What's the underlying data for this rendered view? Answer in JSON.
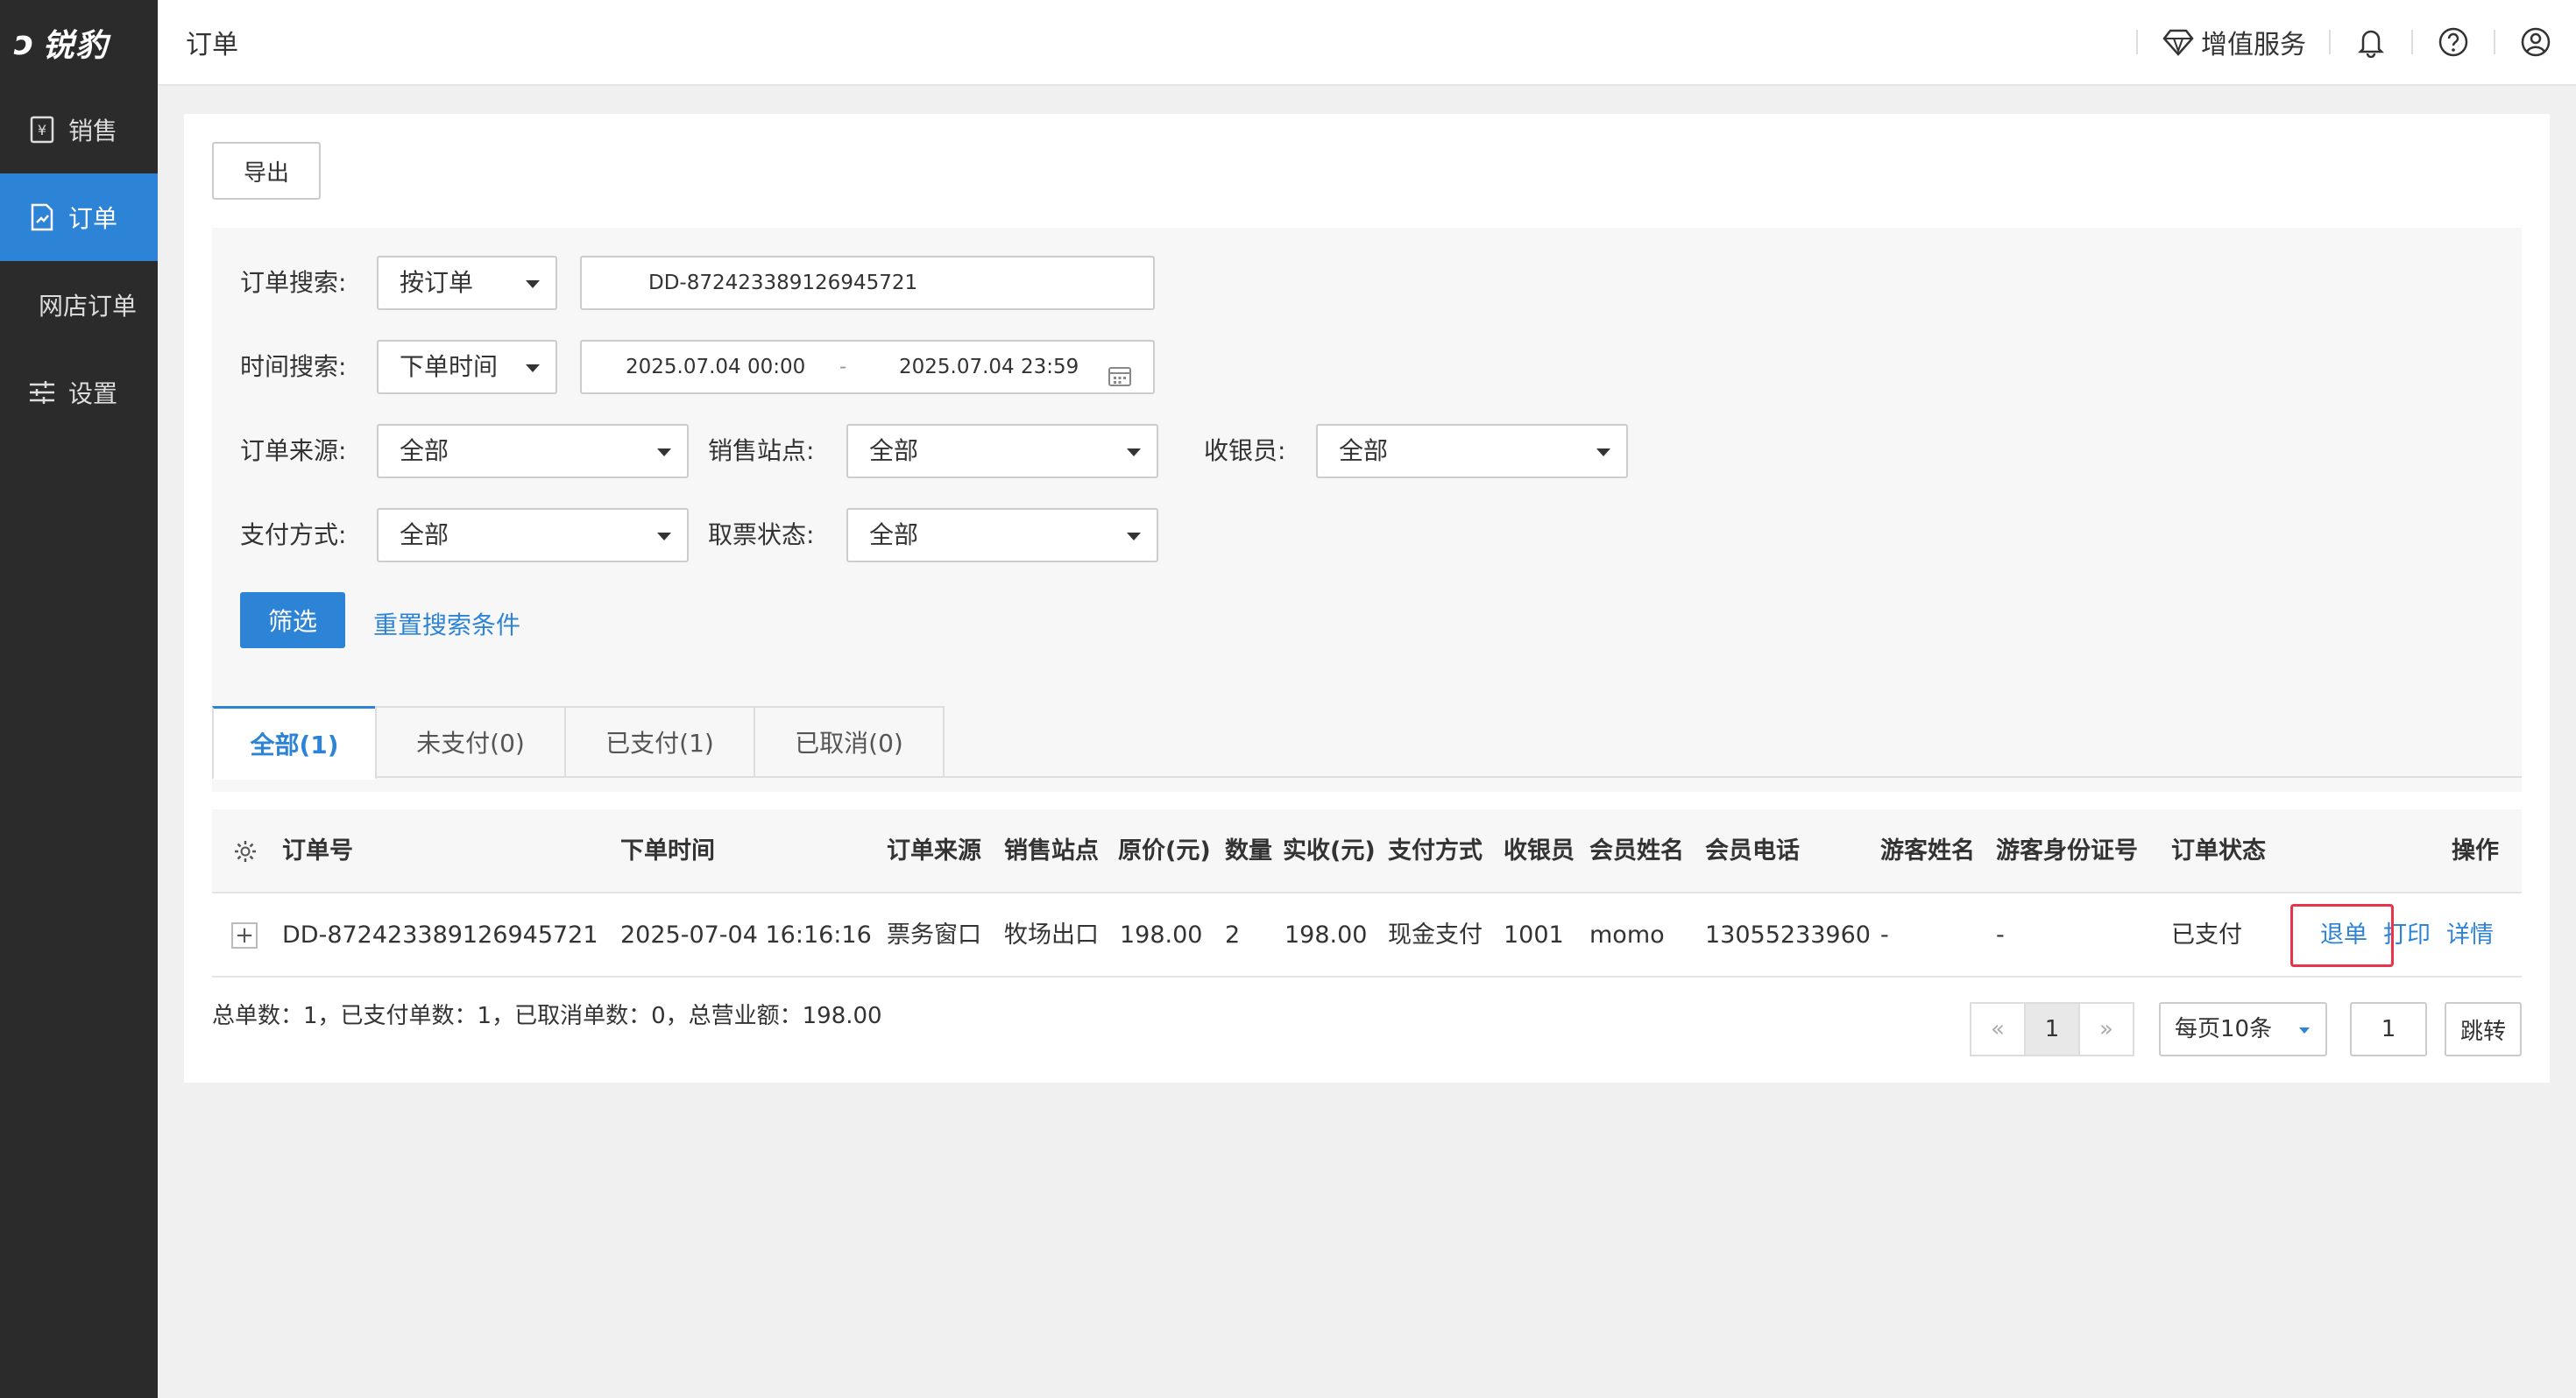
{
  "app": {
    "logo_text": "锐豹"
  },
  "sidebar": {
    "items": [
      {
        "label": "销售",
        "icon": "yen-receipt-icon"
      },
      {
        "label": "订单",
        "icon": "document-chart-icon"
      },
      {
        "label": "网店订单"
      },
      {
        "label": "设置",
        "icon": "sliders-icon"
      }
    ]
  },
  "header": {
    "title": "订单",
    "value_service": "增值服务"
  },
  "toolbar": {
    "export_label": "导出"
  },
  "filters": {
    "order_search_label": "订单搜索:",
    "order_search_type": "按订单",
    "order_search_value": "DD-872423389126945721",
    "time_search_label": "时间搜索:",
    "time_search_type": "下单时间",
    "time_start": "2025.07.04 00:00",
    "time_sep": "-",
    "time_end": "2025.07.04 23:59",
    "source_label": "订单来源:",
    "source_value": "全部",
    "site_label": "销售站点:",
    "site_value": "全部",
    "cashier_label": "收银员:",
    "cashier_value": "全部",
    "pay_label": "支付方式:",
    "pay_value": "全部",
    "ticket_label": "取票状态:",
    "ticket_value": "全部",
    "filter_button": "筛选",
    "reset_link": "重置搜索条件"
  },
  "tabs": [
    {
      "label": "全部(1)",
      "active": true
    },
    {
      "label": "未支付(0)"
    },
    {
      "label": "已支付(1)"
    },
    {
      "label": "已取消(0)"
    }
  ],
  "table": {
    "headers": {
      "order_no": "订单号",
      "time": "下单时间",
      "source": "订单来源",
      "site": "销售站点",
      "price": "原价(元)",
      "qty": "数量",
      "paid": "实收(元)",
      "pay_method": "支付方式",
      "cashier": "收银员",
      "member_name": "会员姓名",
      "member_phone": "会员电话",
      "guest_name": "游客姓名",
      "guest_id": "游客身份证号",
      "status": "订单状态",
      "actions": "操作"
    },
    "rows": [
      {
        "order_no": "DD-872423389126945721",
        "time": "2025-07-04 16:16:16",
        "source": "票务窗口",
        "site": "牧场出口",
        "price": "198.00",
        "qty": "2",
        "paid": "198.00",
        "pay_method": "现金支付",
        "cashier": "1001",
        "member_name": "momo",
        "member_phone": "13055233960",
        "guest_name": "-",
        "guest_id": "-",
        "status": "已支付",
        "action_refund": "退单",
        "action_print": "打印",
        "action_detail": "详情"
      }
    ]
  },
  "summary": "总单数：1，已支付单数：1，已取消单数：0，总营业额：198.00",
  "pagination": {
    "prev": "«",
    "current": "1",
    "next": "»",
    "page_size": "每页10条",
    "jump_value": "1",
    "jump_button": "跳转"
  },
  "colors": {
    "accent": "#2d84d6",
    "sidebar_bg": "#2b2b2b",
    "highlight": "#e8334a"
  }
}
